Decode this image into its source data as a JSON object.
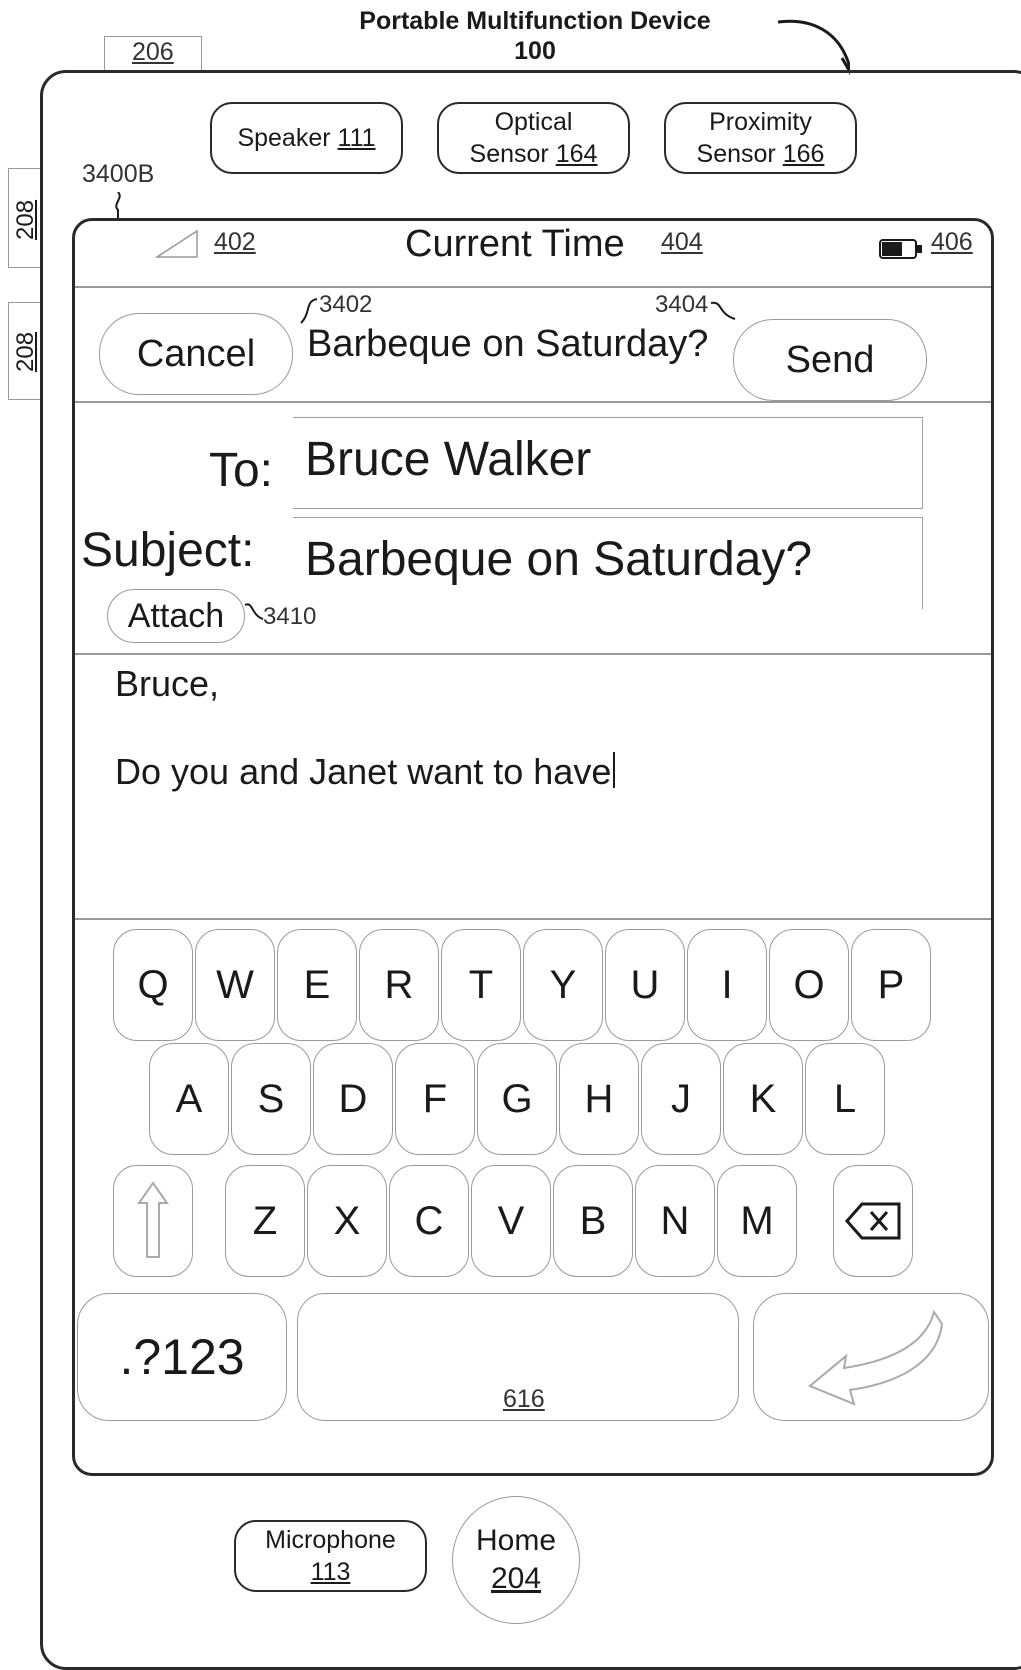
{
  "title": {
    "line1": "Portable Multifunction Device",
    "line2": "100"
  },
  "refs": {
    "r206": "206",
    "r208a": "208",
    "r208b": "208",
    "r3400b": "3400B",
    "r402": "402",
    "r404": "404",
    "r406": "406",
    "r3402": "3402",
    "r3404": "3404",
    "r3410": "3410",
    "r616": "616"
  },
  "hardware": {
    "speaker": {
      "label": "Speaker",
      "ref": "111"
    },
    "optical": {
      "line1": "Optical",
      "line2": "Sensor",
      "ref": "164"
    },
    "proximity": {
      "line1": "Proximity",
      "line2": "Sensor",
      "ref": "166"
    },
    "microphone": {
      "line1": "Microphone",
      "ref": "113"
    },
    "home": {
      "line1": "Home",
      "ref": "204"
    }
  },
  "status_bar": {
    "time": "Current Time",
    "signal_icon": "signal-strength-icon",
    "battery_icon": "battery-icon"
  },
  "nav": {
    "cancel": "Cancel",
    "title": "Barbeque on Saturday?",
    "send": "Send"
  },
  "compose": {
    "to_label": "To:",
    "to_value": "Bruce Walker",
    "subject_label": "Subject:",
    "subject_value": "Barbeque on Saturday?",
    "attach": "Attach",
    "body_line1": "Bruce,",
    "body_line2": "Do you and Janet want to have"
  },
  "keyboard": {
    "row1": [
      "Q",
      "W",
      "E",
      "R",
      "T",
      "Y",
      "U",
      "I",
      "O",
      "P"
    ],
    "row2": [
      "A",
      "S",
      "D",
      "F",
      "G",
      "H",
      "J",
      "K",
      "L"
    ],
    "row3": [
      "Z",
      "X",
      "C",
      "V",
      "B",
      "N",
      "M"
    ],
    "numbers_key": ".?123",
    "shift_icon": "shift-arrow-icon",
    "backspace_icon": "backspace-icon",
    "return_icon": "return-arrow-icon"
  }
}
